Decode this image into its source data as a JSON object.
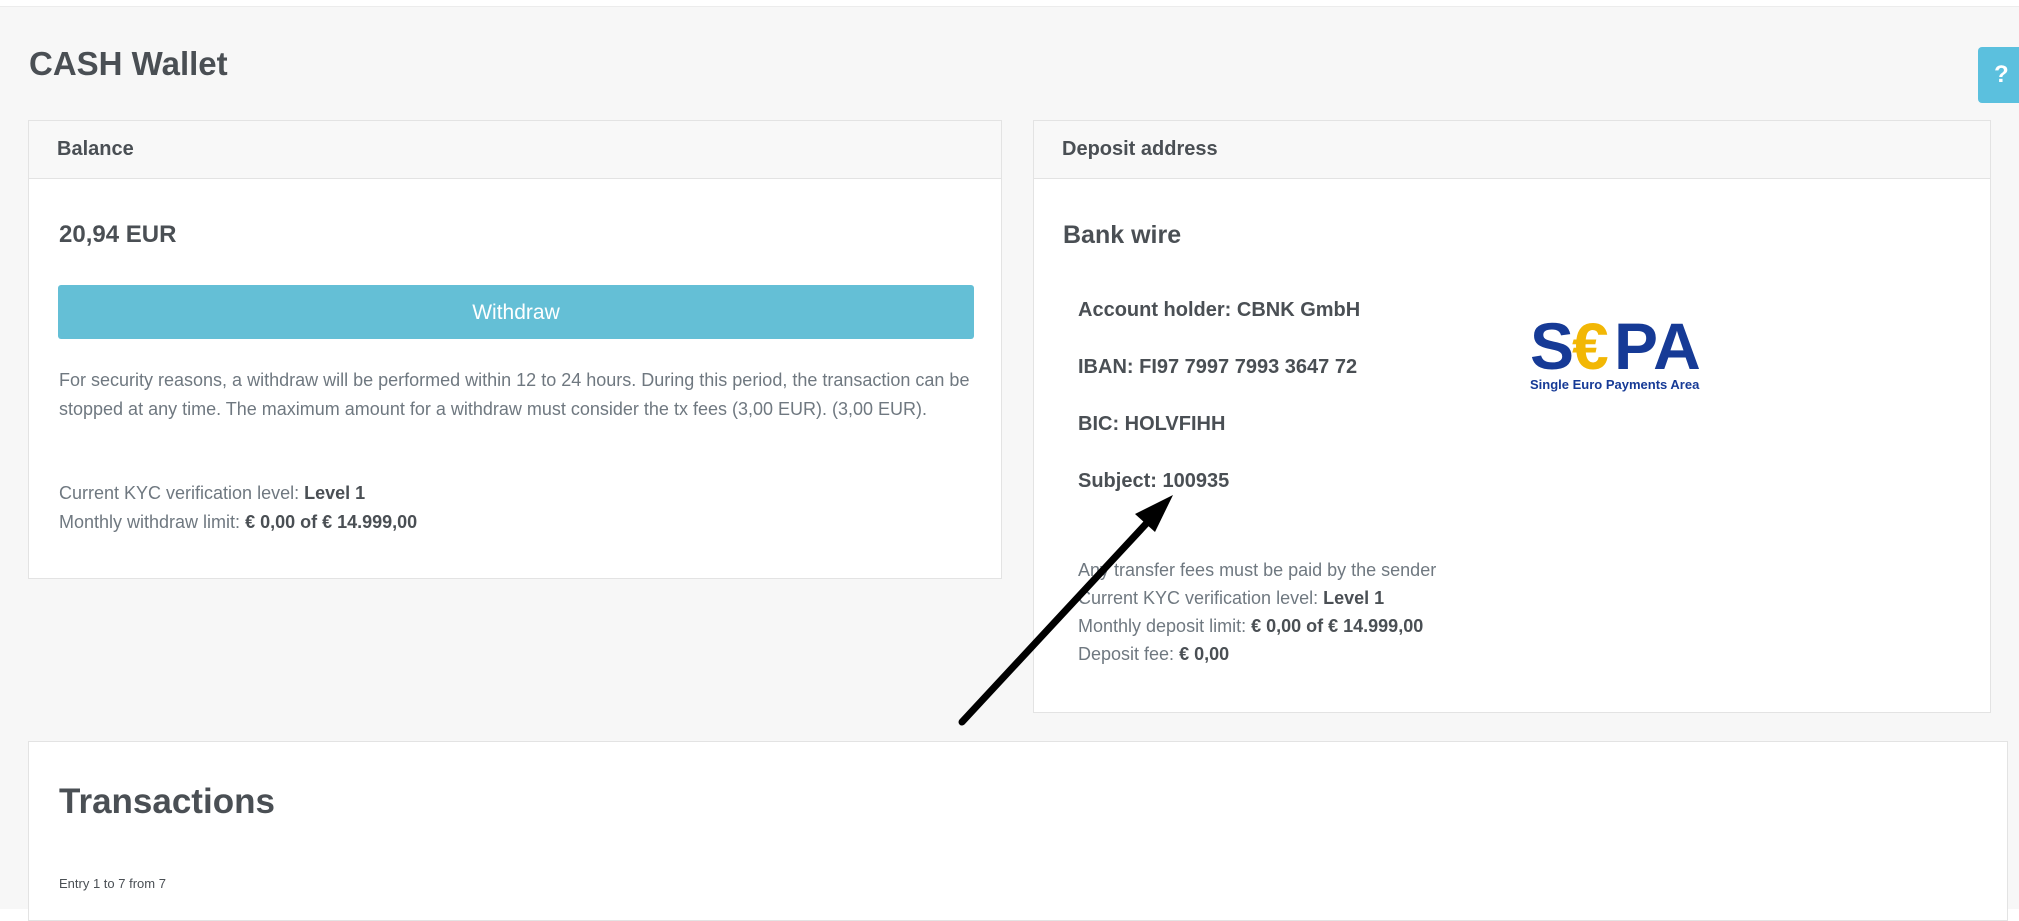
{
  "page": {
    "title": "CASH Wallet",
    "help_label": "?"
  },
  "balance": {
    "header": "Balance",
    "amount": "20,94 EUR",
    "withdraw_label": "Withdraw",
    "note": "For security reasons, a withdraw will be performed within 12 to 24 hours. During this period, the transaction can be stopped at any time. The maximum amount for a withdraw must consider the tx fees (3,00 EUR). (3,00 EUR).",
    "kyc_label": "Current KYC verification level:",
    "kyc_value": "Level 1",
    "limit_label": "Monthly withdraw limit:",
    "limit_value": "€ 0,00 of € 14.999,00"
  },
  "deposit": {
    "header": "Deposit address",
    "method": "Bank wire",
    "account_holder": "Account holder: CBNK GmbH",
    "iban": "IBAN: FI97 7997 7993 3647 72",
    "bic": "BIC: HOLVFIHH",
    "subject": "Subject: 100935",
    "logo_text": "SEPA",
    "logo_subtitle": "Single Euro Payments Area",
    "fees_note": "Any transfer fees must be paid by the sender",
    "kyc_label": "Current KYC verification level:",
    "kyc_value": "Level 1",
    "limit_label": "Monthly deposit limit:",
    "limit_value": "€ 0,00 of € 14.999,00",
    "fee_label": "Deposit fee:",
    "fee_value": "€ 0,00"
  },
  "transactions": {
    "title": "Transactions",
    "entries": "Entry 1 to 7 from 7"
  },
  "colors": {
    "accent": "#64bfd6",
    "help_button": "#5bc0de",
    "sepa_blue": "#163a96",
    "sepa_gold": "#f2b705"
  },
  "icons": {
    "help": "question-mark-icon",
    "annotation": "arrow-annotation-icon"
  }
}
